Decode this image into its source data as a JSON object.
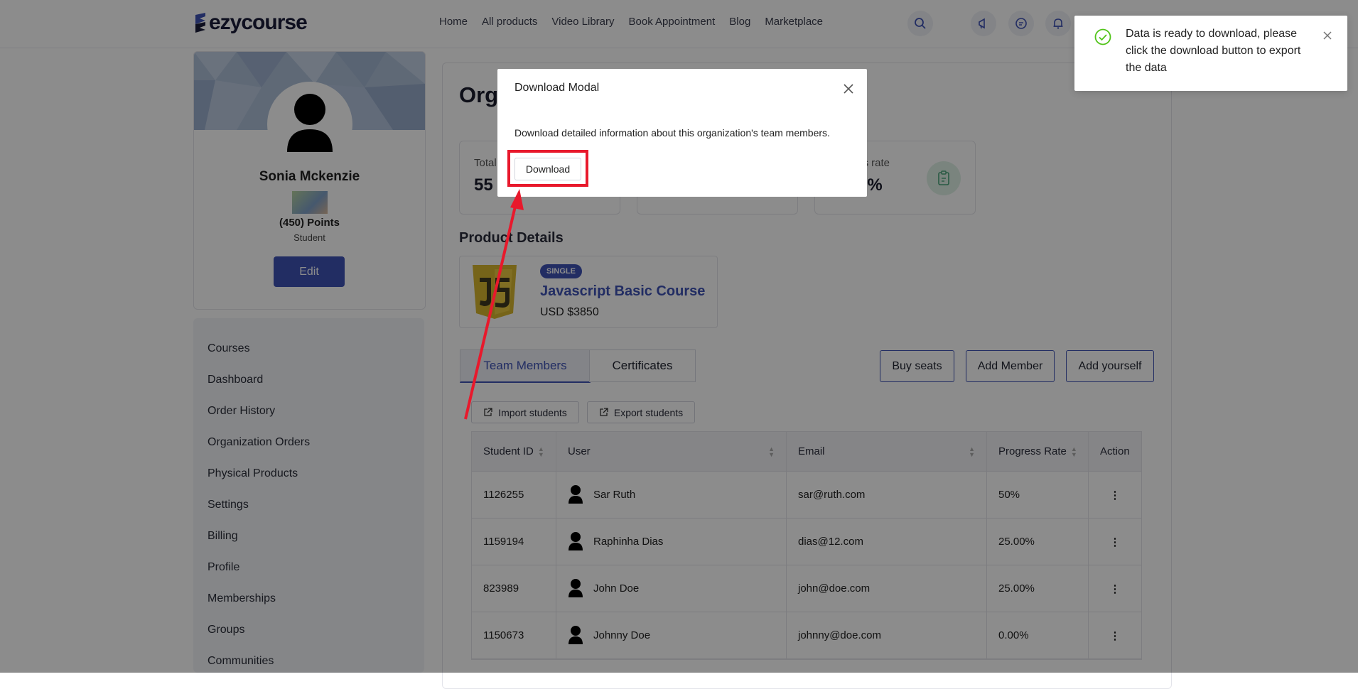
{
  "header": {
    "logo_text": "ezycourse",
    "nav": [
      "Home",
      "All products",
      "Video Library",
      "Book Appointment",
      "Blog",
      "Marketplace"
    ]
  },
  "profile": {
    "name": "Sonia Mckenzie",
    "points": "(450) Points",
    "role": "Student",
    "edit_label": "Edit"
  },
  "sidebar": {
    "items": [
      "Courses",
      "Dashboard",
      "Order History",
      "Organization Orders",
      "Physical Products",
      "Settings",
      "Billing",
      "Profile",
      "Memberships",
      "Groups",
      "Communities"
    ]
  },
  "main": {
    "title_partial": "Org",
    "stats": [
      {
        "label": "Total",
        "value": "55"
      },
      {
        "label": "",
        "value": ""
      },
      {
        "label": "ss rate",
        "value": "3%"
      }
    ],
    "product_section_title": "Product Details",
    "product": {
      "tag": "SINGLE",
      "name": "Javascript Basic Course",
      "price": "USD $3850"
    },
    "tabs": [
      "Team Members",
      "Certificates"
    ],
    "actions": [
      "Buy seats",
      "Add Member",
      "Add yourself"
    ],
    "import_label": "Import students",
    "export_label": "Export students",
    "table": {
      "columns": [
        "Student ID",
        "User",
        "Email",
        "Progress Rate",
        "Action"
      ],
      "rows": [
        {
          "id": "1126255",
          "user": "Sar Ruth",
          "email": "sar@ruth.com",
          "progress": "50%"
        },
        {
          "id": "1159194",
          "user": "Raphinha Dias",
          "email": "dias@12.com",
          "progress": "25.00%"
        },
        {
          "id": "823989",
          "user": "John Doe",
          "email": "john@doe.com",
          "progress": "25.00%"
        },
        {
          "id": "1150673",
          "user": "Johnny Doe",
          "email": "johnny@doe.com",
          "progress": "0.00%"
        }
      ]
    }
  },
  "modal": {
    "title": "Download Modal",
    "body": "Download detailed information about this organization's team members.",
    "download_label": "Download"
  },
  "toast": {
    "message": "Data is ready to download, please click the download button to export the data"
  },
  "colors": {
    "brand": "#3e52b5",
    "highlight": "#e8192c",
    "success": "#52c41a",
    "js_yellow": "#d8b72e"
  }
}
